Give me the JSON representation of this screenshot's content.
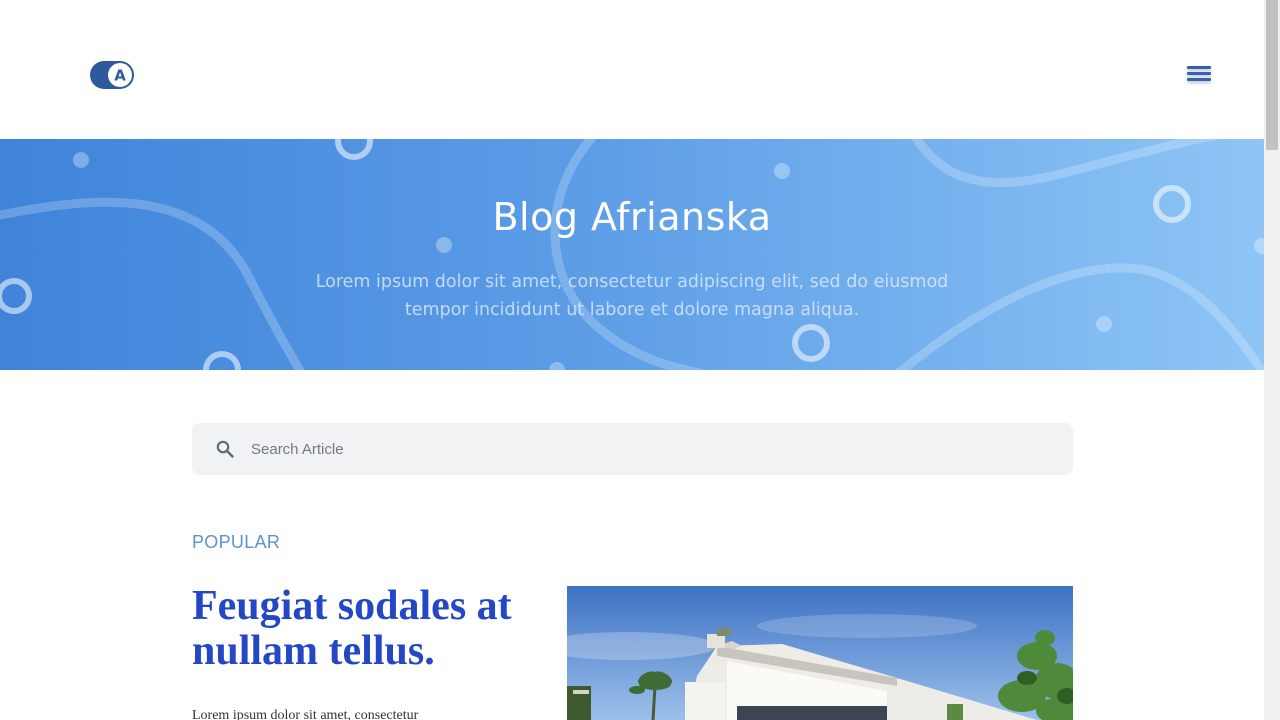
{
  "header": {
    "logo_letter": "A",
    "menu_icon": "hamburger-menu-icon"
  },
  "hero": {
    "title": "Blog Afrianska",
    "subtitle": "Lorem ipsum dolor sit amet, consectetur adipiscing elit, sed do eiusmod tempor incididunt ut labore et dolore magna aliqua."
  },
  "search": {
    "placeholder": "Search Article",
    "value": "",
    "icon": "search-icon"
  },
  "popular": {
    "label": "POPULAR",
    "article": {
      "title": "Feugiat sodales at nullam tellus.",
      "excerpt": "Lorem ipsum dolor sit amet, consectetur",
      "image_icon": "house-photo"
    }
  },
  "colors": {
    "brand": "#2e5a9c",
    "hero_start": "#3f84da",
    "hero_end": "#8ec5f6",
    "title_blue": "#2347c5",
    "label_blue": "#5a94d2"
  }
}
